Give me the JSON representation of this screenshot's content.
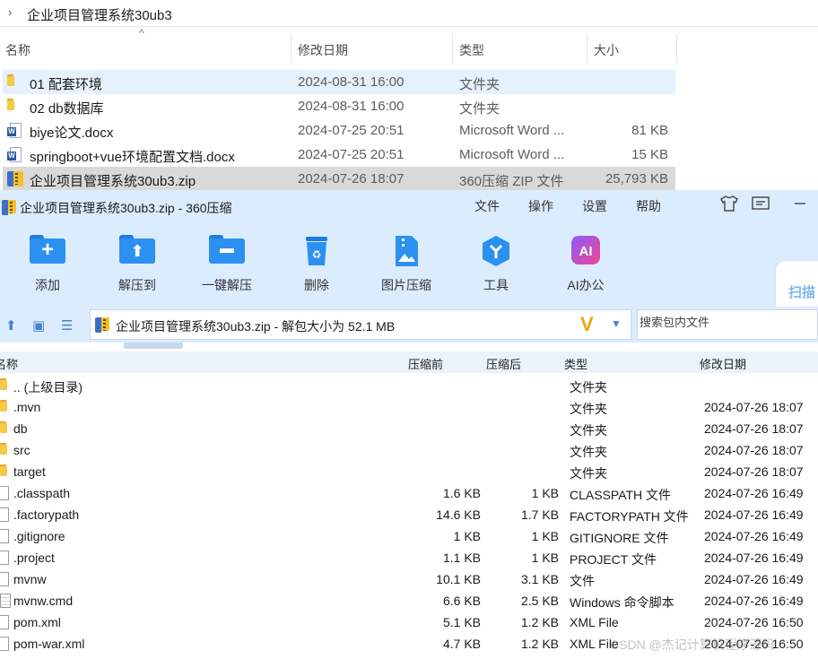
{
  "explorer": {
    "breadcrumb": "企业项目管理系统30ub3",
    "columns": {
      "name": "名称",
      "modified": "修改日期",
      "type": "类型",
      "size": "大小"
    },
    "files": [
      {
        "name": "01 配套环境",
        "modified": "2024-08-31 16:00",
        "type": "文件夹",
        "size": "",
        "icon": "folder-icon"
      },
      {
        "name": "02 db数据库",
        "modified": "2024-08-31 16:00",
        "type": "文件夹",
        "size": "",
        "icon": "folder-icon"
      },
      {
        "name": "biye论文.docx",
        "modified": "2024-07-25 20:51",
        "type": "Microsoft Word ...",
        "size": "81 KB",
        "icon": "word-icon"
      },
      {
        "name": "springboot+vue环境配置文档.docx",
        "modified": "2024-07-25 20:51",
        "type": "Microsoft Word ...",
        "size": "15 KB",
        "icon": "word-icon"
      },
      {
        "name": "企业项目管理系统30ub3.zip",
        "modified": "2024-07-26 18:07",
        "type": "360压缩 ZIP 文件",
        "size": "25,793 KB",
        "icon": "zip-icon"
      }
    ]
  },
  "zip": {
    "title": "企业项目管理系统30ub3.zip - 360压缩",
    "menu": {
      "file": "文件",
      "operate": "操作",
      "settings": "设置",
      "help": "帮助"
    },
    "toolbar": {
      "add": "添加",
      "extract_to": "解压到",
      "one_click_extract": "一键解压",
      "delete": "删除",
      "image_compress": "图片压缩",
      "tools": "工具",
      "ai_office": "AI办公",
      "scan": "扫描"
    },
    "address": {
      "path": "企业项目管理系统30ub3.zip - 解包大小为 52.1 MB",
      "search_placeholder": "搜索包内文件"
    },
    "columns": {
      "name": "名称",
      "before": "压缩前",
      "after": "压缩后",
      "type": "类型",
      "modified": "修改日期"
    },
    "entries": [
      {
        "name": ".. (上级目录)",
        "before": "",
        "after": "",
        "type": "文件夹",
        "modified": "",
        "icon": "folder-icon"
      },
      {
        "name": ".mvn",
        "before": "",
        "after": "",
        "type": "文件夹",
        "modified": "2024-07-26 18:07",
        "icon": "folder-icon"
      },
      {
        "name": "db",
        "before": "",
        "after": "",
        "type": "文件夹",
        "modified": "2024-07-26 18:07",
        "icon": "folder-icon"
      },
      {
        "name": "src",
        "before": "",
        "after": "",
        "type": "文件夹",
        "modified": "2024-07-26 18:07",
        "icon": "folder-icon"
      },
      {
        "name": "target",
        "before": "",
        "after": "",
        "type": "文件夹",
        "modified": "2024-07-26 18:07",
        "icon": "folder-icon"
      },
      {
        "name": ".classpath",
        "before": "1.6 KB",
        "after": "1 KB",
        "type": "CLASSPATH 文件",
        "modified": "2024-07-26 16:49",
        "icon": "file-icon"
      },
      {
        "name": ".factorypath",
        "before": "14.6 KB",
        "after": "1.7 KB",
        "type": "FACTORYPATH 文件",
        "modified": "2024-07-26 16:49",
        "icon": "file-icon"
      },
      {
        "name": ".gitignore",
        "before": "1 KB",
        "after": "1 KB",
        "type": "GITIGNORE 文件",
        "modified": "2024-07-26 16:49",
        "icon": "file-icon"
      },
      {
        "name": ".project",
        "before": "1.1 KB",
        "after": "1 KB",
        "type": "PROJECT 文件",
        "modified": "2024-07-26 16:49",
        "icon": "file-icon"
      },
      {
        "name": "mvnw",
        "before": "10.1 KB",
        "after": "3.1 KB",
        "type": "文件",
        "modified": "2024-07-26 16:49",
        "icon": "file-icon"
      },
      {
        "name": "mvnw.cmd",
        "before": "6.6 KB",
        "after": "2.5 KB",
        "type": "Windows 命令脚本",
        "modified": "2024-07-26 16:49",
        "icon": "cmd-file-icon"
      },
      {
        "name": "pom.xml",
        "before": "5.1 KB",
        "after": "1.2 KB",
        "type": "XML File",
        "modified": "2024-07-26 16:50",
        "icon": "file-icon"
      },
      {
        "name": "pom-war.xml",
        "before": "4.7 KB",
        "after": "1.2 KB",
        "type": "XML File",
        "modified": "2024-07-26 16:50",
        "icon": "file-icon"
      }
    ]
  },
  "watermark": "CSDN @杰记计算机程序源码",
  "colors": {
    "zip_chrome": "#dcecff",
    "folder": "#f7c948",
    "accent_blue": "#2b90f0",
    "selection": "#e5f1fb"
  }
}
